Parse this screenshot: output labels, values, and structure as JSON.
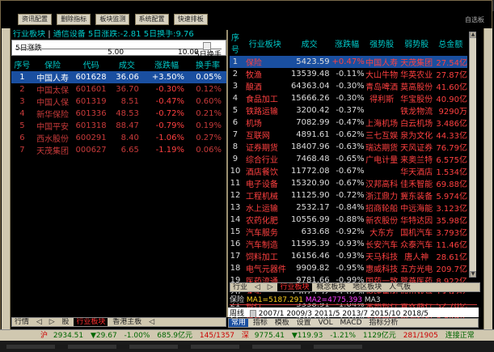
{
  "toolbar": {
    "buttons": [
      "资讯配置",
      "删除指标",
      "板块监测",
      "系统配置",
      "快速排板"
    ],
    "corner": "自选板"
  },
  "left_panel": {
    "header_prefix": "行业板块",
    "header_sep": "|",
    "header_text": "通信设备 5日涨跌:-2.81 5日换手:9.76",
    "strip_label1": "5日涨跌",
    "strip_mark1": "5.00",
    "strip_mark2": "10.00",
    "strip_label2": "5日换手",
    "columns": [
      "序号",
      "保险",
      "代码",
      "成交",
      "涨跌幅",
      "换手率"
    ],
    "rows": [
      {
        "idx": "1",
        "name": "中国人寿",
        "code": "601628",
        "price": "36.06",
        "chg": "+3.50%",
        "turn": "0.05%",
        "dir": "up"
      },
      {
        "idx": "2",
        "name": "中国太保",
        "code": "601601",
        "price": "36.70",
        "chg": "-0.30%",
        "turn": "0.12%",
        "dir": "down"
      },
      {
        "idx": "3",
        "name": "中国人保",
        "code": "601319",
        "price": "8.51",
        "chg": "-0.47%",
        "turn": "0.60%",
        "dir": "down"
      },
      {
        "idx": "4",
        "name": "新华保险",
        "code": "601336",
        "price": "48.53",
        "chg": "-0.72%",
        "turn": "0.21%",
        "dir": "down"
      },
      {
        "idx": "5",
        "name": "中国平安",
        "code": "601318",
        "price": "88.47",
        "chg": "-0.79%",
        "turn": "0.19%",
        "dir": "down"
      },
      {
        "idx": "6",
        "name": "西水股份",
        "code": "600291",
        "price": "8.40",
        "chg": "-1.06%",
        "turn": "0.27%",
        "dir": "down"
      },
      {
        "idx": "7",
        "name": "天茂集团",
        "code": "000627",
        "price": "6.65",
        "chg": "-1.19%",
        "turn": "0.06%",
        "dir": "down"
      }
    ]
  },
  "right_panel": {
    "columns": [
      "序号",
      "行业板块",
      "成交",
      "涨跌幅",
      "强势股",
      "弱势股",
      "总金额"
    ],
    "rows": [
      {
        "idx": "1",
        "name": "保险",
        "vol": "5423.59",
        "chg": "+0.47%",
        "strong": "中国人寿",
        "weak": "天茂集团",
        "amt": "27.54亿",
        "dir": "up"
      },
      {
        "idx": "2",
        "name": "牧渔",
        "vol": "13539.48",
        "chg": "-0.11%",
        "strong": "大山牛物",
        "weak": "华英农业",
        "amt": "27.87亿",
        "dir": "down"
      },
      {
        "idx": "3",
        "name": "酿酒",
        "vol": "64363.04",
        "chg": "-0.30%",
        "strong": "青岛啤酒",
        "weak": "莫高股份",
        "amt": "41.60亿",
        "dir": "down"
      },
      {
        "idx": "4",
        "name": "食品加工",
        "vol": "15666.26",
        "chg": "-0.30%",
        "strong": "得利斯",
        "weak": "华宝股份",
        "amt": "40.90亿",
        "dir": "down"
      },
      {
        "idx": "5",
        "name": "铁路运输",
        "vol": "3200.42",
        "chg": "-0.37%",
        "strong": "",
        "weak": "铁龙物流",
        "amt": "9290万",
        "dir": "down"
      },
      {
        "idx": "6",
        "name": "机场",
        "vol": "7082.99",
        "chg": "-0.47%",
        "strong": "上海机场",
        "weak": "白云机场",
        "amt": "3.486亿",
        "dir": "down"
      },
      {
        "idx": "7",
        "name": "互联网",
        "vol": "4891.61",
        "chg": "-0.62%",
        "strong": "三七互娱",
        "weak": "泉为文化",
        "amt": "44.33亿",
        "dir": "down"
      },
      {
        "idx": "8",
        "name": "证券期货",
        "vol": "18407.96",
        "chg": "-0.63%",
        "strong": "瑞达期货",
        "weak": "天风证券",
        "amt": "76.79亿",
        "dir": "down"
      },
      {
        "idx": "9",
        "name": "综合行业",
        "vol": "7468.48",
        "chg": "-0.65%",
        "strong": "广电计量",
        "weak": "来奥兰特",
        "amt": "6.575亿",
        "dir": "down"
      },
      {
        "idx": "10",
        "name": "酒店餐饮",
        "vol": "11772.08",
        "chg": "-0.67%",
        "strong": "",
        "weak": "华天酒店",
        "amt": "1.534亿",
        "dir": "down"
      },
      {
        "idx": "11",
        "name": "电子设备",
        "vol": "15320.90",
        "chg": "-0.67%",
        "strong": "汉邦高科",
        "weak": "佳禾智能",
        "amt": "69.88亿",
        "dir": "down"
      },
      {
        "idx": "12",
        "name": "工程机械",
        "vol": "11125.90",
        "chg": "-0.72%",
        "strong": "浙江鼎力",
        "weak": "冀东装备",
        "amt": "5.974亿",
        "dir": "down"
      },
      {
        "idx": "13",
        "name": "水上运输",
        "vol": "2532.17",
        "chg": "-0.84%",
        "strong": "招商轮船",
        "weak": "中远海能",
        "amt": "3.123亿",
        "dir": "down"
      },
      {
        "idx": "14",
        "name": "农药化肥",
        "vol": "10556.99",
        "chg": "-0.88%",
        "strong": "新农股份",
        "weak": "华特达因",
        "amt": "35.98亿",
        "dir": "down"
      },
      {
        "idx": "15",
        "name": "汽车服务",
        "vol": "633.68",
        "chg": "-0.92%",
        "strong": "大东方",
        "weak": "国机汽车",
        "amt": "3.793亿",
        "dir": "down"
      },
      {
        "idx": "16",
        "name": "汽车制造",
        "vol": "11595.39",
        "chg": "-0.93%",
        "strong": "长安汽车",
        "weak": "众泰汽车",
        "amt": "11.46亿",
        "dir": "down"
      },
      {
        "idx": "17",
        "name": "饲料加工",
        "vol": "16156.46",
        "chg": "-0.93%",
        "strong": "天马科技",
        "weak": "唐人神",
        "amt": "28.61亿",
        "dir": "down"
      },
      {
        "idx": "18",
        "name": "电气元器件",
        "vol": "9909.82",
        "chg": "-0.95%",
        "strong": "惠威科技",
        "weak": "五方光电",
        "amt": "209.7亿",
        "dir": "down"
      },
      {
        "idx": "19",
        "name": "医药流通",
        "vol": "9781.66",
        "chg": "-0.99%",
        "strong": "国药一致",
        "weak": "鹭燕医药",
        "amt": "8.922亿",
        "dir": "down"
      },
      {
        "idx": "20",
        "name": "水泥",
        "vol": "15673.52",
        "chg": "-1.02%",
        "strong": "塔牌集团",
        "weak": "四川双马",
        "amt": "13.92亿",
        "dir": "down"
      },
      {
        "idx": "21",
        "name": "银行",
        "vol": "5338.91",
        "chg": "-1.04%",
        "strong": "常熟银行",
        "weak": "青农商行",
        "amt": "52.70亿",
        "dir": "down"
      },
      {
        "idx": "22",
        "name": "建材",
        "vol": "4169.88",
        "chg": "-1.10%",
        "strong": "蒙娜丽莎",
        "weak": "顺灏科技",
        "amt": "8.849亿",
        "dir": "down"
      }
    ]
  },
  "right_tabs": [
    "行业",
    "◁",
    "▷",
    "行业板块",
    "概念板块",
    "地区板块",
    "人气板"
  ],
  "left_tabs": [
    "行情",
    "◁",
    "▷",
    "股",
    "行业板块",
    "香港主板",
    "◁"
  ],
  "ma_strip": {
    "prefix": "保险",
    "ma1": "MA1=5187.291",
    "ma2": "MA2=4775.393",
    "code": "MA3"
  },
  "period_bar": {
    "label": "周线",
    "years": [
      "2007/1",
      "2009/3",
      "2011/5",
      "2013/7",
      "2015/10",
      "2018/5"
    ]
  },
  "bottom_toolbar": [
    "常用",
    "指标",
    "模板",
    "设置",
    "VOL",
    "MACD",
    "指标分析"
  ],
  "status": {
    "label": "沪",
    "sh_index": "2934.51",
    "sh_chg": "▼29.67",
    "sh_pct": "-1.00%",
    "sh_amt": "685.9亿元",
    "sh_updown": "145/1357",
    "sz_label": "深",
    "sz_index": "9775.41",
    "sz_chg": "▼119.93",
    "sz_pct": "-1.21%",
    "sz_amt": "1129亿元",
    "sz_updown": "281/1905",
    "conn": "连接正常"
  },
  "colors": {
    "up": "#ff4040",
    "down": "#40c040",
    "accent": "#00c8c8",
    "selected": "#1a4fa0"
  }
}
